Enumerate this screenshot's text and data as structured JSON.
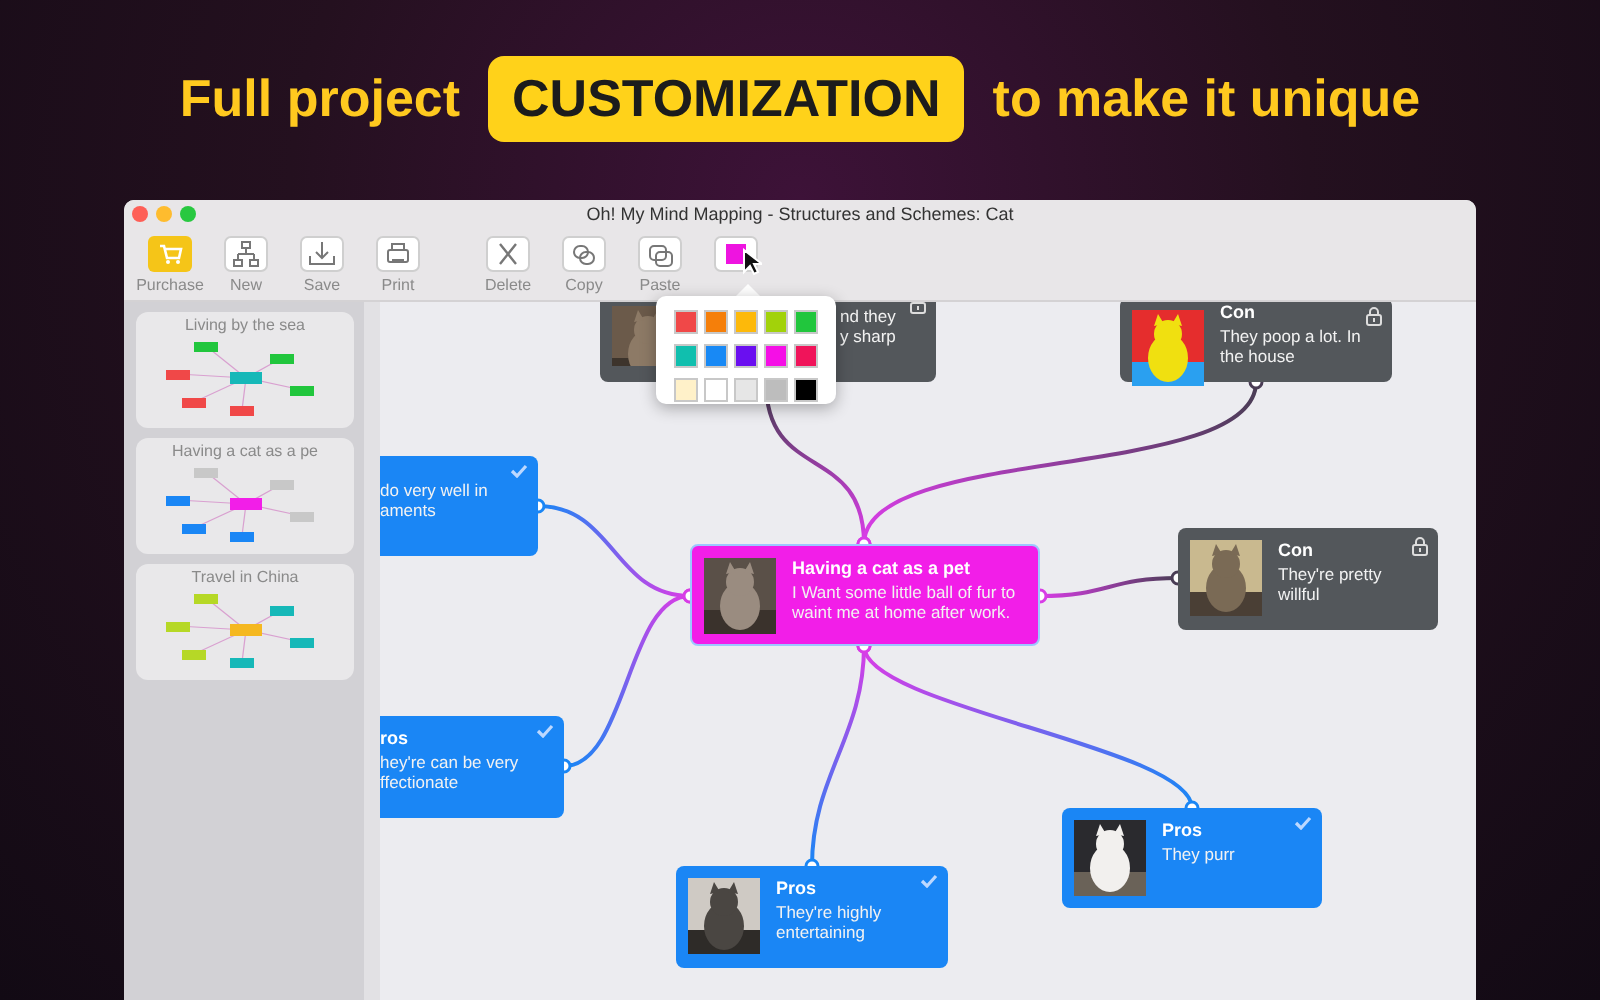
{
  "headline": {
    "before": "Full project",
    "badge": "CUSTOMIZATION",
    "after": "to make it unique"
  },
  "window": {
    "title": "Oh! My Mind Mapping - Structures and Schemes: Cat"
  },
  "toolbar": [
    {
      "kind": "purchase",
      "label": "Purchase"
    },
    {
      "kind": "new",
      "label": "New"
    },
    {
      "kind": "save",
      "label": "Save"
    },
    {
      "kind": "print",
      "label": "Print"
    },
    {
      "kind": "delete",
      "label": "Delete"
    },
    {
      "kind": "copy",
      "label": "Copy"
    },
    {
      "kind": "paste",
      "label": "Paste"
    },
    {
      "kind": "color"
    }
  ],
  "palette": [
    {
      "color": "#f04848"
    },
    {
      "color": "#f57f0a"
    },
    {
      "color": "#fdb90a"
    },
    {
      "color": "#a2d20a"
    },
    {
      "color": "#21c63d"
    },
    {
      "color": "#10bfae"
    },
    {
      "color": "#1889f5"
    },
    {
      "color": "#6a0ff0"
    },
    {
      "color": "#f50fe6"
    },
    {
      "color": "#f0145a"
    },
    {
      "color": "#fff1c9"
    },
    {
      "color": "#ffffff"
    },
    {
      "color": "#e6e6e6"
    },
    {
      "color": "#bdbdbd"
    },
    {
      "color": "#000000"
    }
  ],
  "sidebar": {
    "maps": [
      {
        "title": "Living by the sea"
      },
      {
        "title": "Having a cat as a pe"
      },
      {
        "title": "Travel in China"
      }
    ]
  },
  "map": {
    "nodes": [
      {
        "kind": "topic",
        "color": "#53575b",
        "lines": [
          "nd they",
          "y sharp"
        ],
        "picture": true,
        "done": false,
        "locked": true
      },
      {
        "kind": "topic",
        "color": "#53575b",
        "title": "Con",
        "lines": [
          "They poop a lot. In",
          "the house"
        ],
        "picture": true,
        "done": false,
        "locked": true
      },
      {
        "kind": "central",
        "color": "#f21ee8",
        "title": "Having a cat as a pet",
        "lines": [
          "I Want some little ball of fur to",
          "waint me at home after work."
        ],
        "picture": true,
        "done": false,
        "locked": false
      },
      {
        "kind": "topic",
        "color": "#53575b",
        "title": "Con",
        "lines": [
          "They're pretty",
          "willful"
        ],
        "picture": true,
        "done": false,
        "locked": true
      },
      {
        "kind": "topic",
        "color": "#1a86f5",
        "lines": [
          "do very well in",
          "aments"
        ],
        "picture": false,
        "done": true,
        "locked": false
      },
      {
        "kind": "topic",
        "color": "#1a86f5",
        "title": "ros",
        "lines": [
          "hey're can be very",
          "ffectionate"
        ],
        "picture": false,
        "done": true,
        "locked": false
      },
      {
        "kind": "topic",
        "color": "#1a86f5",
        "title": "Pros",
        "lines": [
          "They're highly",
          "entertaining"
        ],
        "picture": true,
        "done": true,
        "locked": false
      },
      {
        "kind": "topic",
        "color": "#1a86f5",
        "title": "Pros",
        "lines": [
          "They purr"
        ],
        "picture": true,
        "done": true,
        "locked": false
      }
    ]
  }
}
